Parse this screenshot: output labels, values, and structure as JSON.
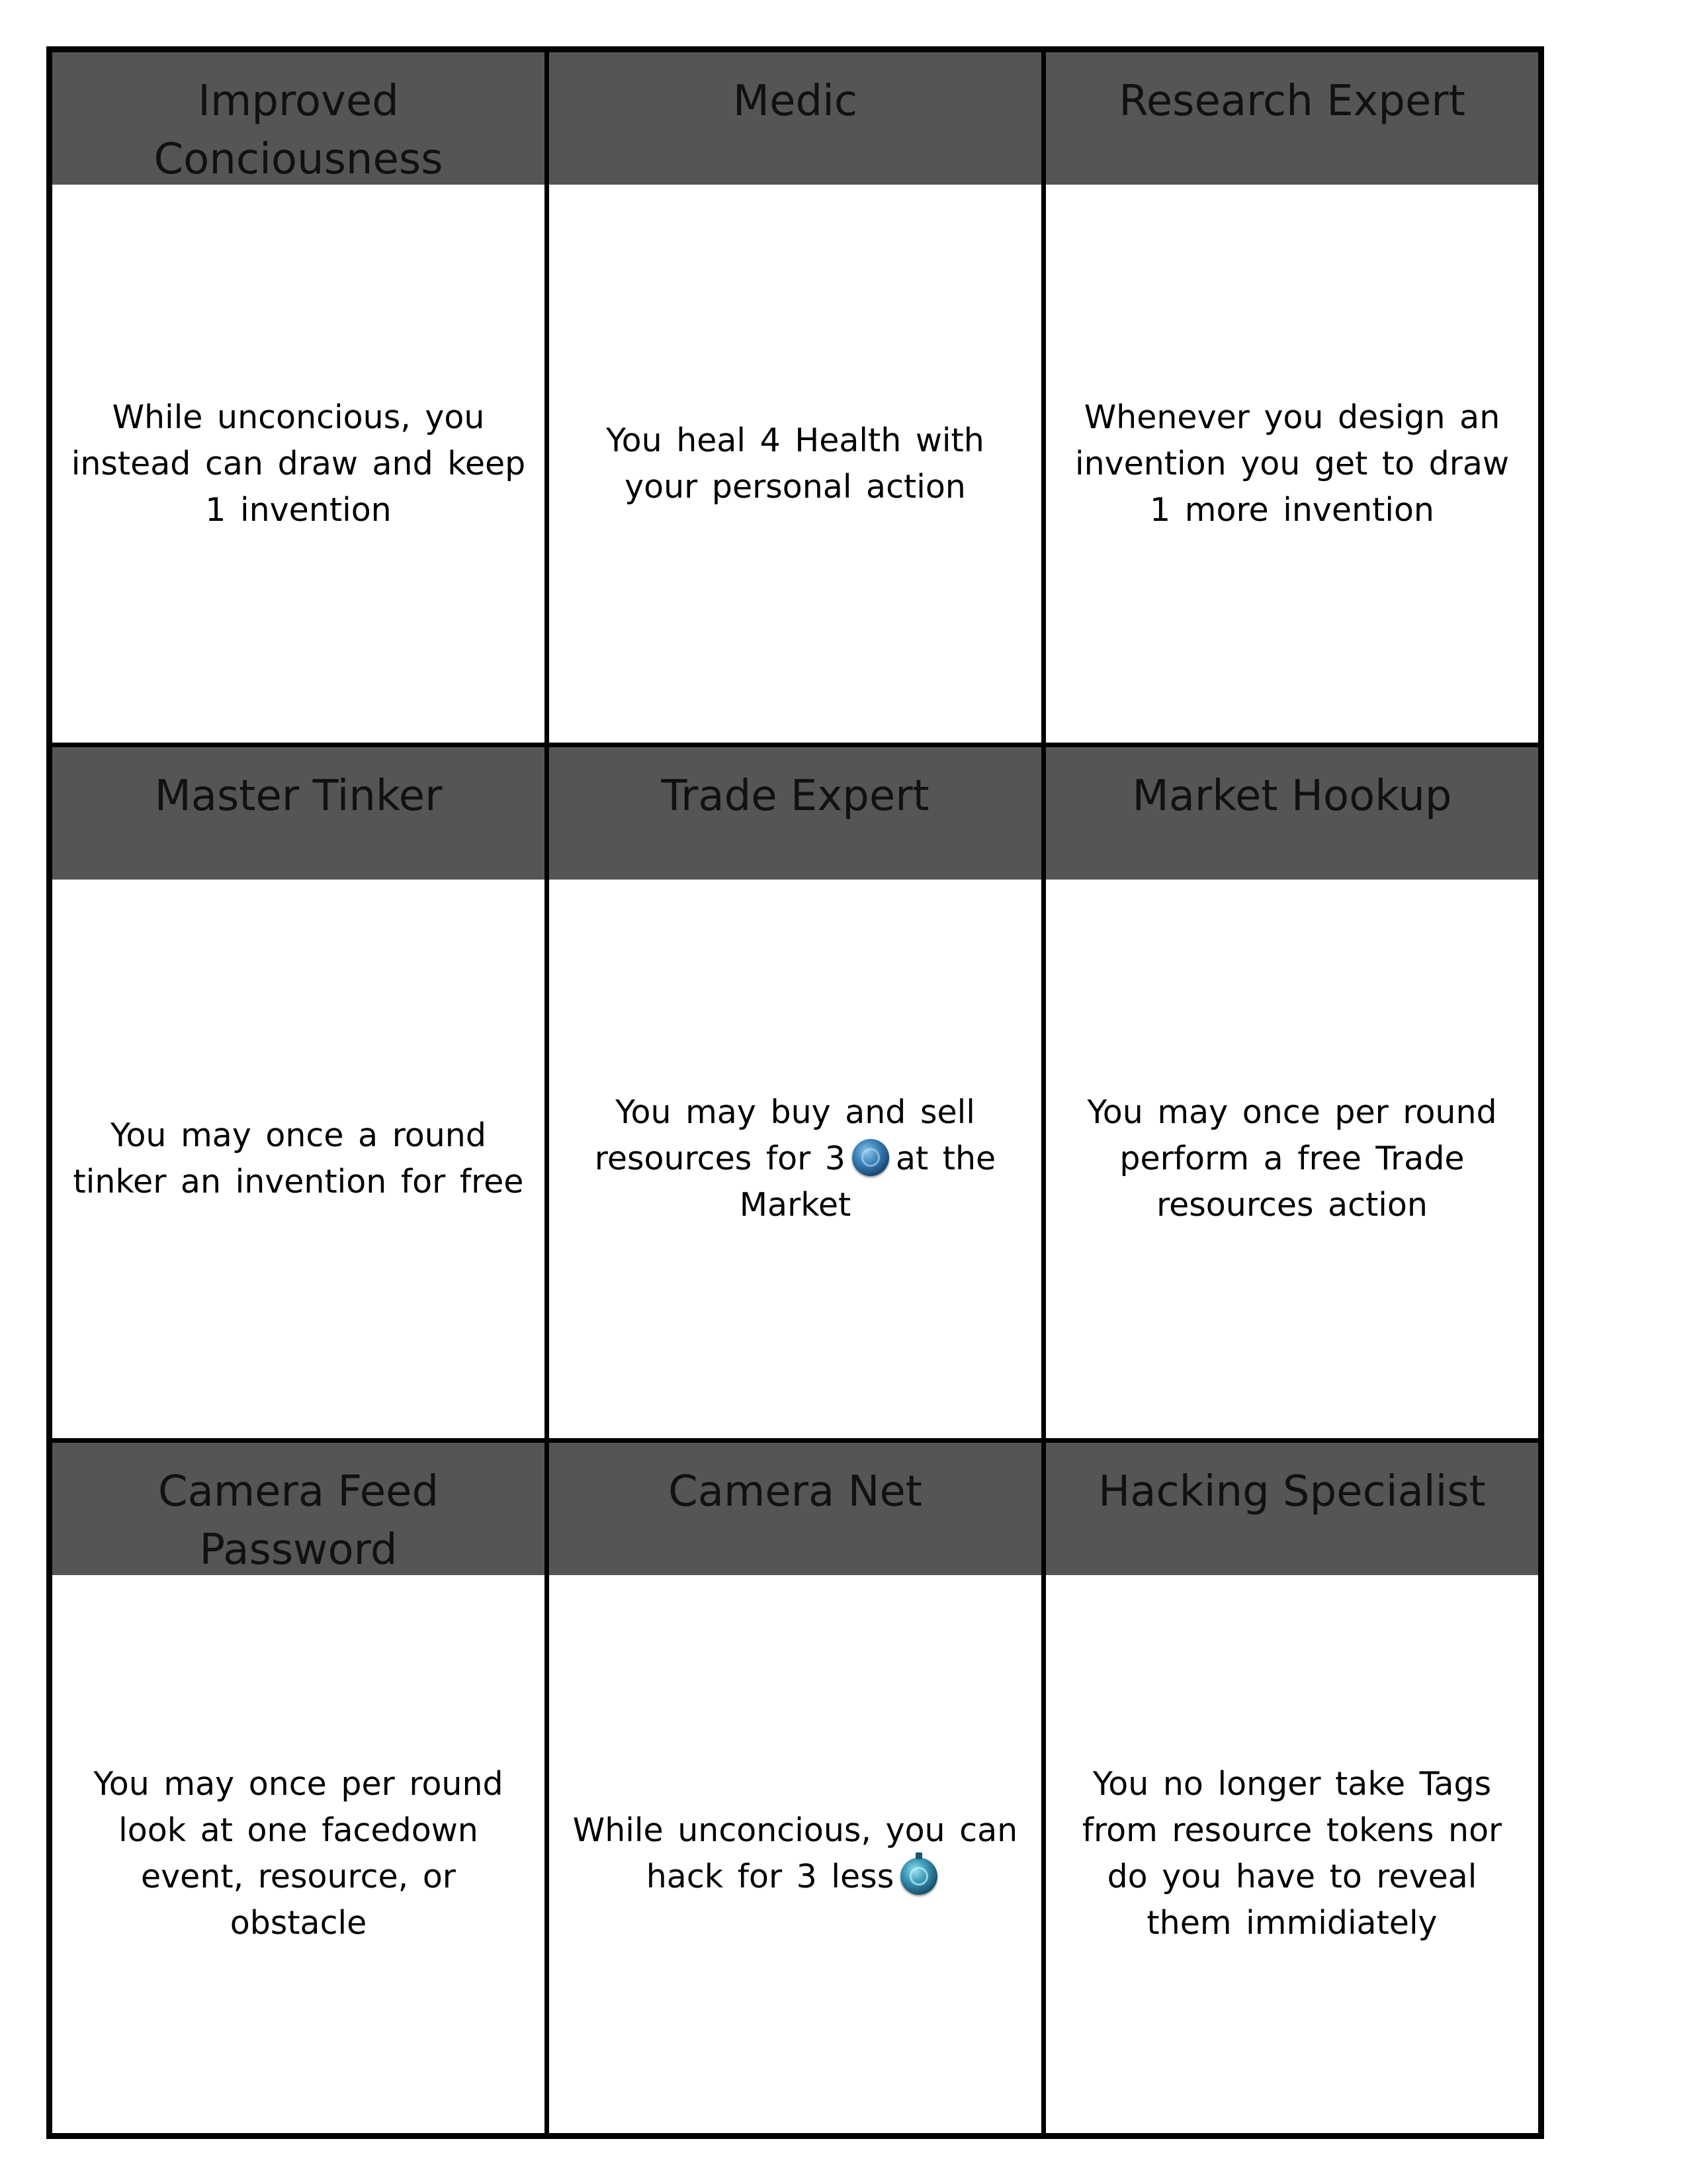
{
  "cards": [
    {
      "title": "Improved Conciousness",
      "text": "While unconcious, you instead can draw and keep 1 invention"
    },
    {
      "title": "Medic",
      "text": "You heal 4 Health with your personal action"
    },
    {
      "title": "Research Expert",
      "text": "Whenever you design an invention you get to draw 1 more invention"
    },
    {
      "title": "Master Tinker",
      "text": "You may once a round tinker an invention for free"
    },
    {
      "title": "Trade Expert",
      "text_before_icon": "You may buy and sell resources for 3",
      "icon": "coin-icon",
      "text_after_icon": "at the Market"
    },
    {
      "title": "Market Hookup",
      "text": "You may once per round perform a free Trade resources action"
    },
    {
      "title": "Camera Feed Password",
      "text": "You may once per round look at one facedown event, resource, or obstacle"
    },
    {
      "title": "Camera Net",
      "text_before_icon": "While unconcious, you can hack for 3 less",
      "icon": "timer-icon",
      "text_after_icon": ""
    },
    {
      "title": "Hacking Specialist",
      "text": "You no longer take Tags from resource tokens nor do you have to reveal them immidiately"
    }
  ],
  "colors": {
    "header_bg": "#555555",
    "border": "#000000",
    "card_bg": "#ffffff"
  }
}
